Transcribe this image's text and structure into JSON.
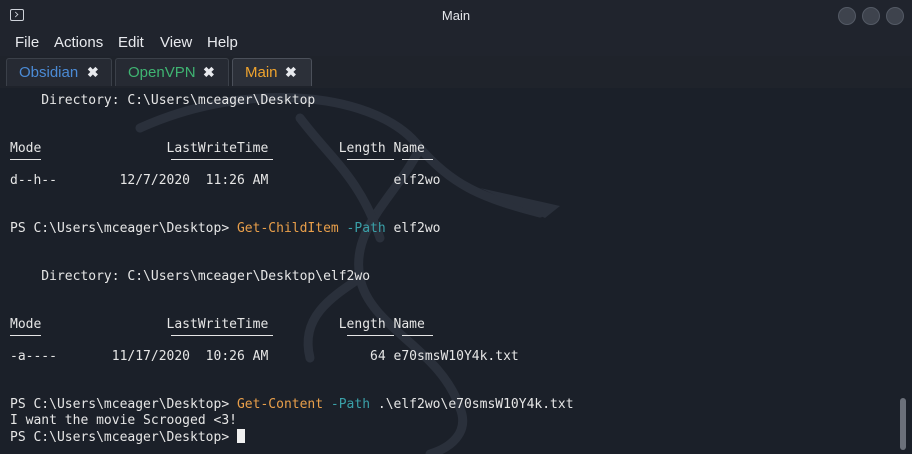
{
  "window": {
    "title": "Main"
  },
  "menu": [
    "File",
    "Actions",
    "Edit",
    "View",
    "Help"
  ],
  "tabs": [
    {
      "label": "Obsidian",
      "color": "#4b8bd6",
      "close": "✖"
    },
    {
      "label": "OpenVPN",
      "color": "#3fb472",
      "close": "✖"
    },
    {
      "label": "Main",
      "color": "#f0a42e",
      "close": "✖"
    }
  ],
  "terminal": {
    "dir1": "    Directory: C:\\Users\\mceager\\Desktop",
    "header1": "Mode                LastWriteTime         Length Name",
    "row1": "d--h--        12/7/2020  11:26 AM                elf2wo",
    "prompt1": "PS C:\\Users\\mceager\\Desktop> ",
    "cmd1": "Get-ChildItem",
    "param1": " -Path",
    "arg1": " elf2wo",
    "dir2": "    Directory: C:\\Users\\mceager\\Desktop\\elf2wo",
    "header2": "Mode                LastWriteTime         Length Name",
    "row2": "-a----       11/17/2020  10:26 AM             64 e70smsW10Y4k.txt",
    "prompt2": "PS C:\\Users\\mceager\\Desktop> ",
    "cmd2": "Get-Content",
    "param2": " -Path",
    "arg2": " .\\elf2wo\\e70smsW10Y4k.txt",
    "output": "I want the movie Scrooged <3!",
    "prompt3": "PS C:\\Users\\mceager\\Desktop> "
  }
}
